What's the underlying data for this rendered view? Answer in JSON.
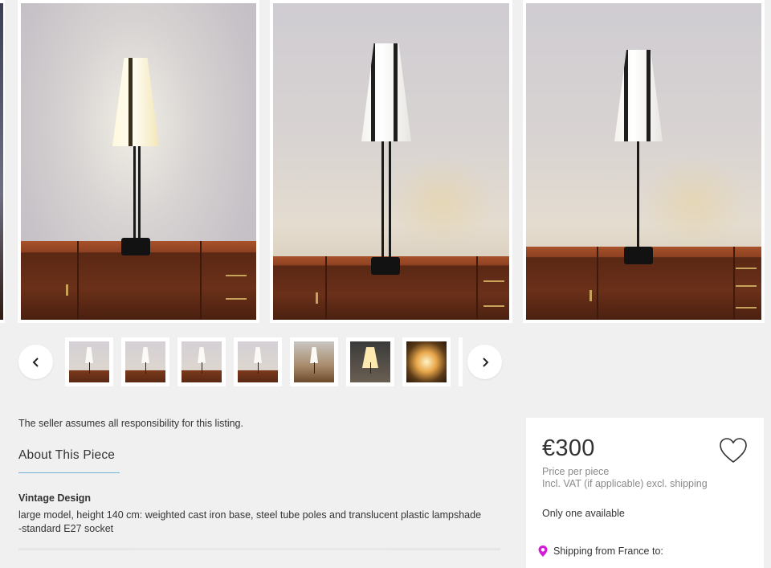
{
  "gallery": {
    "photos": [
      {
        "label": "Lamp photo 1 (lit)"
      },
      {
        "label": "Lamp photo 2"
      },
      {
        "label": "Lamp photo 3"
      }
    ],
    "thumbnails_count": 7
  },
  "nav": {
    "prev_icon": "chevron-left-icon",
    "next_icon": "chevron-right-icon"
  },
  "listing": {
    "disclaimer": "The seller assumes all responsibility for this listing.",
    "about_heading": "About This Piece",
    "desc_title": "Vintage Design",
    "desc_line1": "large model, height 140 cm: weighted cast iron base, steel tube poles and translucent plastic lampshade",
    "desc_line2": "-standard E27 socket"
  },
  "purchase": {
    "price": "€300",
    "per_piece": "Price per piece",
    "vat_note": "Incl. VAT (if applicable) excl. shipping",
    "availability": "Only one available",
    "shipping": "Shipping from France to:",
    "favorite_icon": "heart-icon",
    "location_icon": "location-pin-icon",
    "location_color": "#d21cd8"
  }
}
